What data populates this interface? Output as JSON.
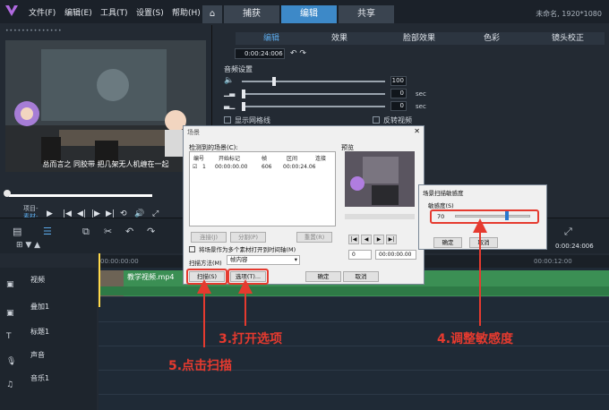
{
  "menu": [
    "文件(F)",
    "编辑(E)",
    "工具(T)",
    "设置(S)",
    "帮助(H)"
  ],
  "tabs": [
    "捕获",
    "编辑",
    "共享"
  ],
  "project_info": "未命名, 1920*1080",
  "preview": {
    "caption": "总而言之 同胶带 把几架无人机缠在一起",
    "project_label": "项目-",
    "clip_label": "素材-",
    "controls": [
      "▶",
      "|◀",
      "◀|",
      "|▶",
      "▶|",
      "⟲",
      "🔊",
      "⤢"
    ]
  },
  "edit_panel": {
    "tabs": [
      "编辑",
      "效果",
      "脸部效果",
      "色彩",
      "镜头校正"
    ],
    "time": "0:00:24:006",
    "audio_settings": "音频设置",
    "volume": "100",
    "fade_in": "0",
    "fade_out": "0",
    "sec": "sec",
    "show_grid": "显示网格线",
    "reverse": "反转视频"
  },
  "timeline": {
    "timecode": "0:00:24:006",
    "ruler_start": "00:00:00:00",
    "ruler_end": "00:00:12:00",
    "tracks": [
      "视频",
      "叠加1",
      "标题1",
      "声音",
      "音乐1"
    ],
    "clip_name": "教学视频.mp4"
  },
  "scene_dialog": {
    "title": "场景",
    "detected_label": "检测到的场景(C):",
    "preview_label": "预览",
    "columns": [
      "编号",
      "开始标记",
      "帧",
      "区间",
      "连接"
    ],
    "row": [
      "1",
      "00:00:00.00",
      "606",
      "00:00:24.06",
      ""
    ],
    "join_btn": "连接(J)",
    "split_btn": "分割(P)",
    "reset_btn": "重置(R)",
    "multi_label": "将场景作为多个素材打开到时间轴(M)",
    "method_label": "扫描方法(M)",
    "method_value": "帧内容",
    "scan_btn": "扫描(S)",
    "options_btn": "选项(T)...",
    "ok_btn": "确定",
    "cancel_btn": "取消",
    "pv_time1": "0",
    "pv_time2": "00:00:00.00"
  },
  "sens_dialog": {
    "title": "场景扫描敏感度",
    "label": "敏感度(S)",
    "value": 70,
    "ok": "确定",
    "cancel": "取消"
  },
  "annotations": {
    "step3": "3.打开选项",
    "step4": "4.调整敏感度",
    "step5": "5.点击扫描"
  },
  "colors": {
    "accent": "#3d89c8",
    "annotation": "#e53a2f",
    "clip": "#3b8f54"
  }
}
